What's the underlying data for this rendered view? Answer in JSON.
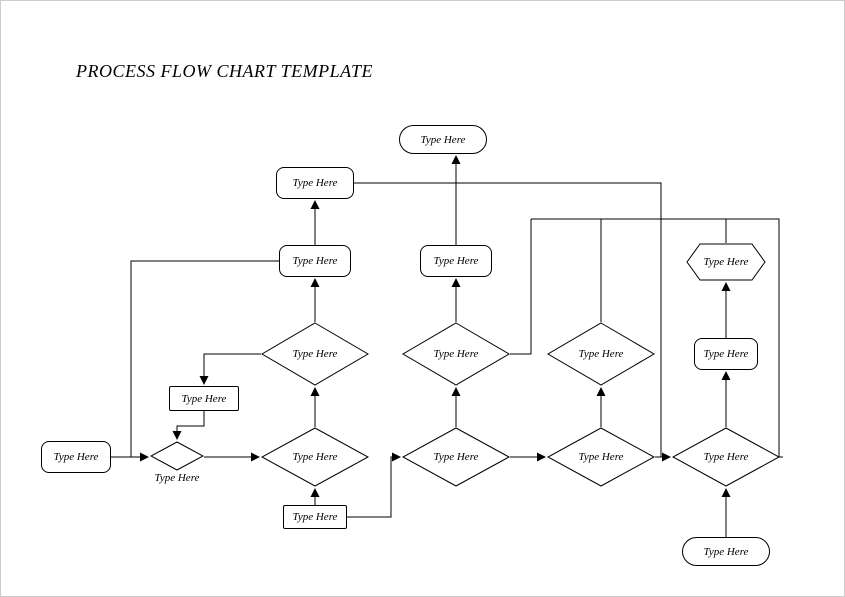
{
  "title": "PROCESS FLOW CHART TEMPLATE",
  "nodes": {
    "t_top": "Type Here",
    "r_top": "Type Here",
    "r_mid1": "Type Here",
    "d_col1_top": "Type Here",
    "sr_mid": "Type Here",
    "r_start": "Type Here",
    "d_small": "Type Here",
    "d_col1_bot": "Type Here",
    "sr_bot": "Type Here",
    "r_col2_mid": "Type Here",
    "d_col2_top": "Type Here",
    "d_col2_bot": "Type Here",
    "d_col3_top": "Type Here",
    "d_col3_bot": "Type Here",
    "hex": "Type Here",
    "r_col4_mid": "Type Here",
    "d_col4_bot": "Type Here",
    "t_bot": "Type Here"
  }
}
